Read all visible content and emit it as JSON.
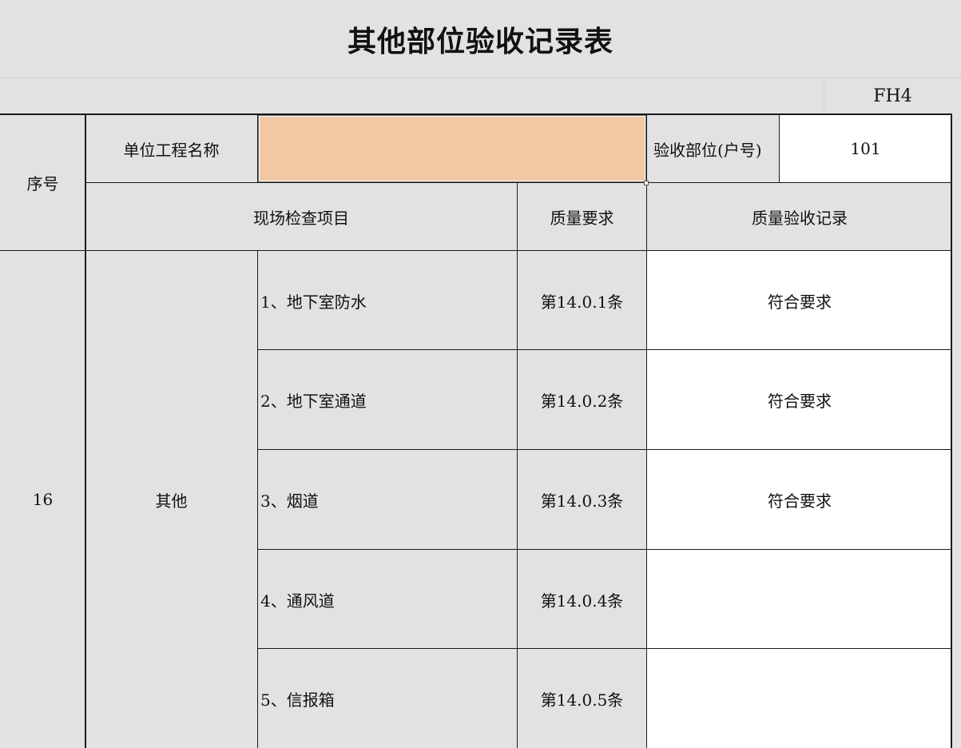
{
  "title": "其他部位验收记录表",
  "form_code": "FH4",
  "header": {
    "seq_label": "序号",
    "unit_name_label": "单位工程名称",
    "unit_name_value": "",
    "location_label": "验收部位(户号)",
    "location_value": "101",
    "inspection_items_label": "现场检查项目",
    "quality_requirement_label": "质量要求",
    "quality_record_label": "质量验收记录"
  },
  "group": {
    "seq": "16",
    "category": "其他"
  },
  "rows": [
    {
      "item": "1、地下室防水",
      "requirement": "第14.0.1条",
      "record": "符合要求"
    },
    {
      "item": "2、地下室通道",
      "requirement": "第14.0.2条",
      "record": "符合要求"
    },
    {
      "item": "3、烟道",
      "requirement": "第14.0.3条",
      "record": "符合要求"
    },
    {
      "item": "4、通风道",
      "requirement": "第14.0.4条",
      "record": ""
    },
    {
      "item": "5、信报箱",
      "requirement": "第14.0.5条",
      "record": ""
    }
  ]
}
